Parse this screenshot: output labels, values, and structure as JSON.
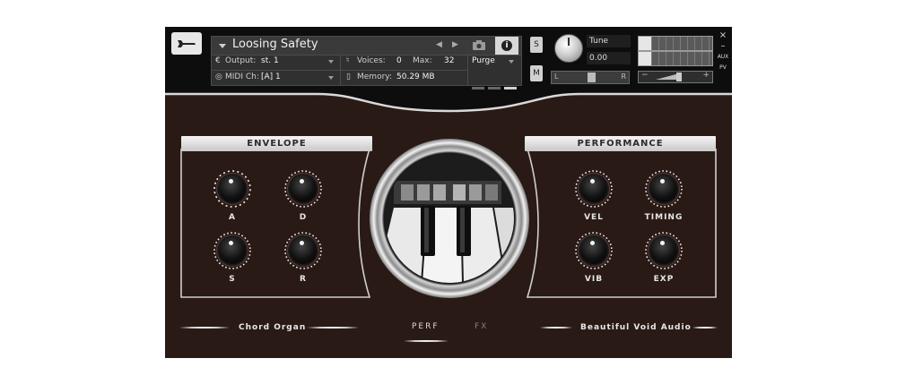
{
  "header": {
    "instrument_name": "Loosing Safety",
    "output_label": "Output:",
    "output_value": "st. 1",
    "voices_label": "Voices:",
    "voices_value": "0",
    "max_label": "Max:",
    "max_value": "32",
    "purge_label": "Purge",
    "midi_label": "MIDI Ch:",
    "midi_value": "[A]  1",
    "memory_label": "Memory:",
    "memory_value": "50.29 MB",
    "solo_label": "S",
    "mute_label": "M",
    "tune_label": "Tune",
    "tune_value": "0.00",
    "pan_left": "L",
    "pan_right": "R",
    "vol_minus": "−",
    "vol_plus": "+",
    "close_label": "×",
    "minimize_label": "–",
    "aux_label": "AUX",
    "pv_label": "PV"
  },
  "envelope": {
    "title": "ENVELOPE",
    "knobs": [
      {
        "label": "A"
      },
      {
        "label": "D"
      },
      {
        "label": "S"
      },
      {
        "label": "R"
      }
    ]
  },
  "performance": {
    "title": "PERFORMANCE",
    "knobs": [
      {
        "label": "VEL"
      },
      {
        "label": "TIMING"
      },
      {
        "label": "VIB"
      },
      {
        "label": "EXP"
      }
    ]
  },
  "footer": {
    "product_name": "Chord Organ",
    "brand": "Beautiful Void Audio",
    "tabs": [
      {
        "label": "PERF",
        "active": true
      },
      {
        "label": "FX",
        "active": false
      }
    ]
  },
  "colors": {
    "background": "#2a1a16",
    "header": "#0d0d0d",
    "panel_title": "#e2e2e2",
    "frame": "#cfcfcf"
  }
}
